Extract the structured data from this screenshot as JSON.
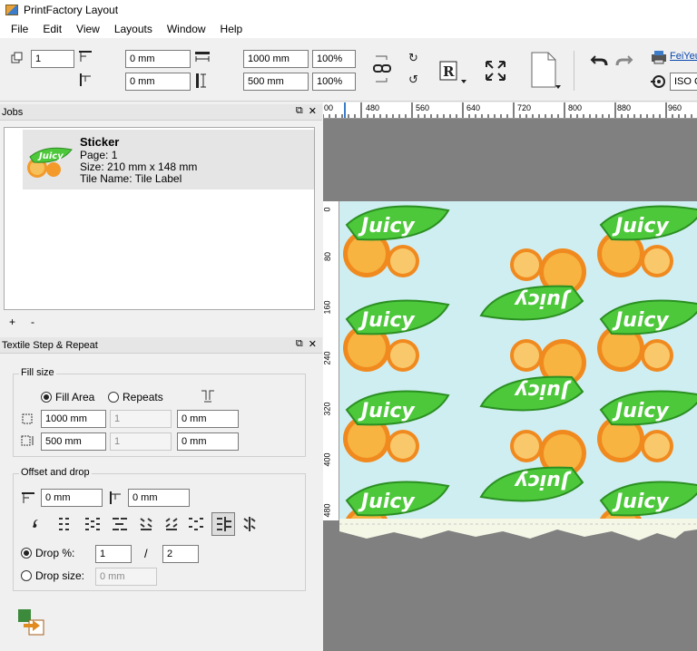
{
  "app": {
    "title": "PrintFactory Layout"
  },
  "menu": [
    "File",
    "Edit",
    "View",
    "Layouts",
    "Window",
    "Help"
  ],
  "toolbar": {
    "copies": "1",
    "h_offset": "0 mm",
    "v_offset": "0 mm",
    "width": "1000 mm",
    "height": "500 mm",
    "scale_x": "100%",
    "scale_y": "100%",
    "printer_link": "FeiYeu",
    "profile": "ISO C"
  },
  "jobs_panel": {
    "title": "Jobs",
    "items": [
      {
        "name": "Sticker",
        "page": "Page: 1",
        "size": "Size: 210 mm x 148 mm",
        "tile": "Tile Name: Tile Label"
      }
    ],
    "add": "+",
    "remove": "-"
  },
  "textile_panel": {
    "title": "Textile Step & Repeat",
    "fill_size": {
      "legend": "Fill size",
      "fill_area_label": "Fill Area",
      "repeats_label": "Repeats",
      "width": "1000 mm",
      "width_repeats": "1",
      "width_gap": "0 mm",
      "height": "500 mm",
      "height_repeats": "1",
      "height_gap": "0 mm"
    },
    "offset_drop": {
      "legend": "Offset and drop",
      "offset_h": "0 mm",
      "offset_v": "0 mm",
      "drop_pct_label": "Drop %:",
      "drop_num": "1",
      "drop_slash": "/",
      "drop_den": "2",
      "drop_size_label": "Drop size:",
      "drop_size": "0 mm"
    }
  },
  "ruler": {
    "top": [
      "00",
      "480",
      "560",
      "640",
      "720",
      "800",
      "880",
      "960"
    ],
    "left": [
      "0",
      "80",
      "160",
      "240",
      "320",
      "400",
      "480"
    ]
  },
  "artwork": {
    "word": "Juicy"
  },
  "colors": {
    "accent": "#3c7cc9",
    "leaf": "#4cc83a",
    "sheet": "#cfeef2",
    "canvas": "#808080"
  }
}
